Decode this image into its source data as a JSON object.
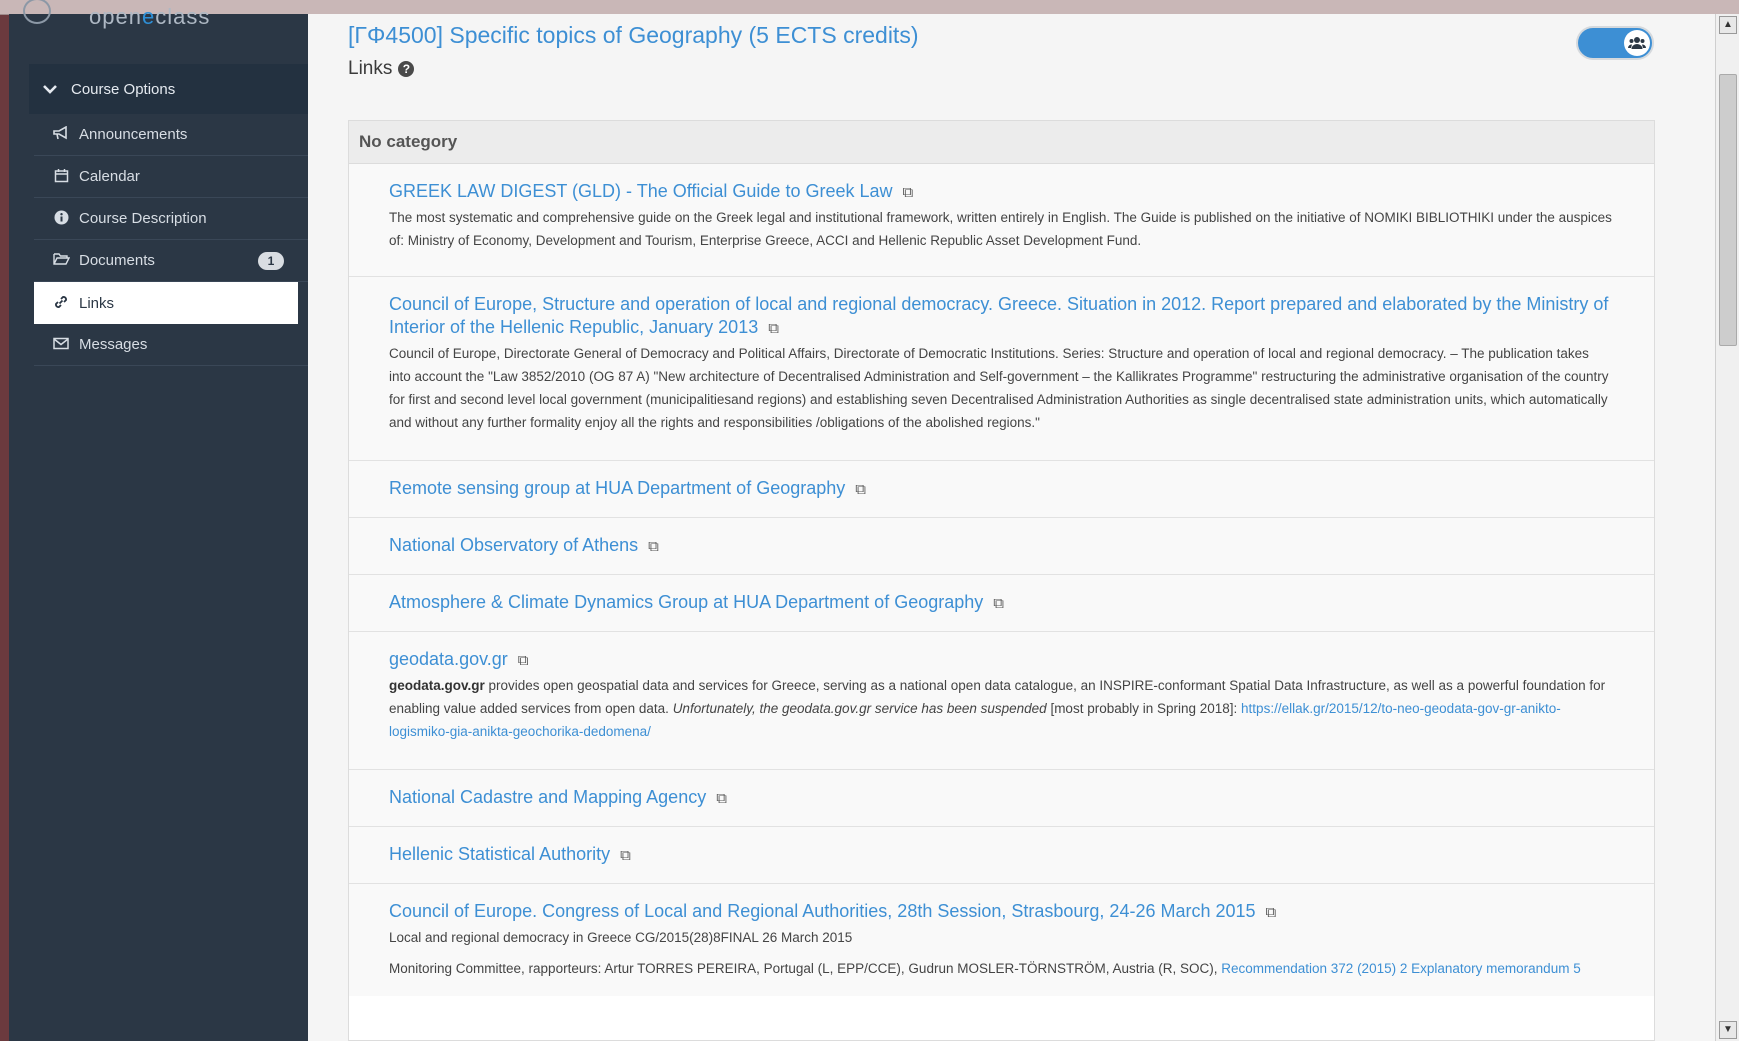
{
  "sidebar": {
    "logo": {
      "part1": "open",
      "dot": "e",
      "part2": "class"
    },
    "course_options": "Course Options",
    "items": [
      {
        "label": "Announcements",
        "icon": "bullhorn-icon"
      },
      {
        "label": "Calendar",
        "icon": "calendar-icon"
      },
      {
        "label": "Course Description",
        "icon": "info-icon"
      },
      {
        "label": "Documents",
        "icon": "folder-icon",
        "badge": "1"
      },
      {
        "label": "Links",
        "icon": "link-icon",
        "active": true
      },
      {
        "label": "Messages",
        "icon": "envelope-icon"
      }
    ]
  },
  "header": {
    "course_title": "[ΓΦ4500] Specific topics of Geography (5 ECTS credits)",
    "subtitle": "Links"
  },
  "panel": {
    "category": "No category",
    "links": [
      {
        "title": "GREEK LAW DIGEST (GLD) - The Official Guide to Greek Law",
        "desc": "The most systematic and comprehensive guide on the Greek legal and institutional framework, written entirely in English. The Guide is published on the initiative of NOMIKI BIBLIOTHIKI under the auspices of: Ministry of Economy, Development and Tourism, Enterprise Greece, ACCI and Hellenic Republic Asset Development Fund."
      },
      {
        "title": "Council of Europe, Structure and operation of local and regional democracy. Greece. Situation in 2012. Report prepared and elaborated by the Ministry of Interior of the Hellenic Republic, January 2013",
        "desc": "Council of Europe, Directorate General of Democracy and Political Affairs, Directorate of Democratic Institutions. Series:  Structure and operation of local and regional democracy. – The publication takes into account the \"Law 3852/2010 (OG 87 A) \"New architecture of Decentralised Administration and Self-government – the Kallikrates Programme\" restructuring the administrative organisation of the country for first and second level local government (municipalitiesand regions) and establishing seven Decentralised Administration Authorities as single decentralised state administration units, which automatically and without any further formality enjoy all the rights and responsibilities /obligations of the abolished regions.\""
      },
      {
        "title": "Remote sensing group at HUA Department of Geography"
      },
      {
        "title": "National Observatory of Athens"
      },
      {
        "title": "Atmosphere & Climate Dynamics Group at HUA Department of Geography"
      },
      {
        "title": "geodata.gov.gr",
        "desc_bold": "geodata.gov.gr",
        "desc_a": " provides open geospatial data and services for Greece, serving as a national open data catalogue, an INSPIRE-conformant Spatial Data Infrastructure, as well as a powerful foundation for enabling value added services from open data. ",
        "desc_em": "Unfortunately, the geodata.gov.gr service has been suspended",
        "desc_b": " [most probably in Spring 2018]: ",
        "desc_link": "https://ellak.gr/2015/12/to-neo-geodata-gov-gr-anikto-logismiko-gia-anikta-geochorika-dedomena/"
      },
      {
        "title": "National Cadastre and Mapping Agency"
      },
      {
        "title": "Hellenic Statistical Authority"
      },
      {
        "title": "Council of Europe. Congress of Local and Regional Authorities, 28th Session, Strasbourg, 24-26 March 2015",
        "desc1": "Local and regional democracy in Greece   CG/2015(28)8FINAL  26 March 2015",
        "desc2": "Monitoring Committee, rapporteurs: Artur TORRES PEREIRA, Portugal (L, EPP/CCE), Gudrun MOSLER-TÖRNSTRÖM, Austria (R, SOC), ",
        "desc2_link1": "Recommendation 372 (2015) 2",
        "desc2_link2": "Explanatory memorandum 5"
      }
    ]
  },
  "colors": {
    "sidebar": "#2b3745",
    "accent": "#3d8fd4",
    "background": "#6b3a3e"
  }
}
